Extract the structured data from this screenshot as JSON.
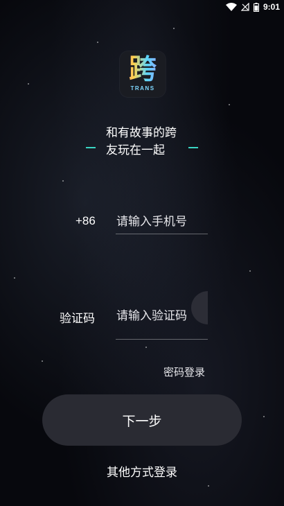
{
  "status_bar": {
    "time": "9:01",
    "icons": [
      "wifi-icon",
      "sim-icon",
      "battery-icon"
    ]
  },
  "logo": {
    "glyph": "跨",
    "sub_text": "TRANS"
  },
  "slogan": {
    "text": "和有故事的跨友玩在一起"
  },
  "phone": {
    "country_code": "+86",
    "placeholder": "请输入手机号",
    "value": ""
  },
  "verification": {
    "label": "验证码",
    "placeholder": "请输入验证码",
    "value": ""
  },
  "links": {
    "password_login": "密码登录",
    "other_login": "其他方式登录"
  },
  "buttons": {
    "next": "下一步"
  },
  "colors": {
    "background": "#07080d",
    "button": "#2a2b33",
    "accent_dash": "#3ad6c4"
  }
}
